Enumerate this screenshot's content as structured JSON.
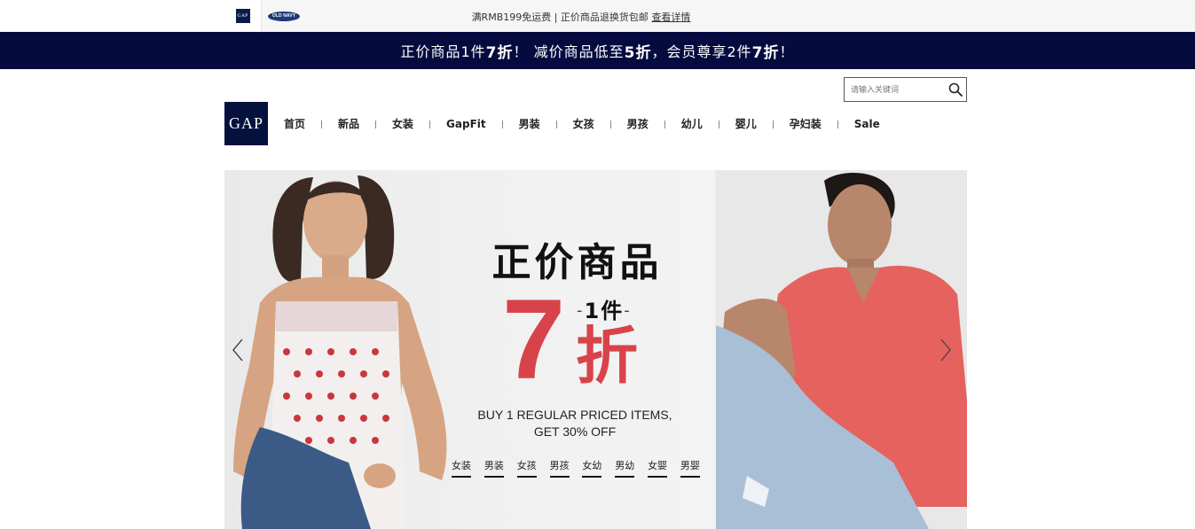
{
  "topbar": {
    "brands": [
      {
        "name": "GAP",
        "label": "GAP"
      },
      {
        "name": "Old Navy",
        "label": "OLD NAVY"
      }
    ],
    "shipping_text": "满RMB199免运费 | 正价商品退换货包邮 ",
    "details_link": "查看详情"
  },
  "promo": {
    "part1": "正价商品1件",
    "part1_bold": "7折",
    "part2": "！ 减价商品低至",
    "part2_bold": "5折",
    "part3": "，会员尊享2件",
    "part3_bold": "7折",
    "part4": "！"
  },
  "search": {
    "placeholder": "请输入关键词"
  },
  "logo": {
    "text": "GAP"
  },
  "nav": {
    "items": [
      "首页",
      "新品",
      "女装",
      "GapFit",
      "男装",
      "女孩",
      "男孩",
      "幼儿",
      "婴儿",
      "孕妇装",
      "Sale"
    ]
  },
  "hero": {
    "title": "正价商品",
    "qty": "1件",
    "big_number": "7",
    "zhe": "折",
    "en_line1": "BUY 1 REGULAR PRICED ITEMS,",
    "en_line2": "GET 30% OFF",
    "categories": [
      "女装",
      "男装",
      "女孩",
      "男孩",
      "女幼",
      "男幼",
      "女婴",
      "男婴"
    ]
  },
  "colors": {
    "navy": "#060b3f",
    "accent_red": "#d8434b"
  }
}
